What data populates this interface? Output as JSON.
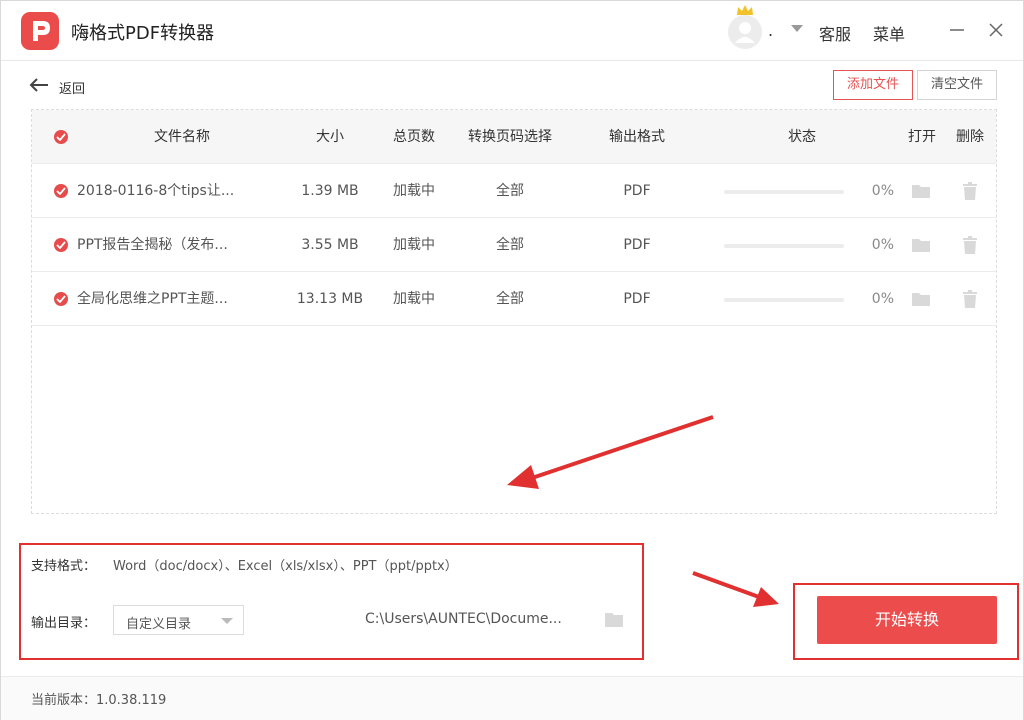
{
  "app": {
    "title": "嗨格式PDF转换器"
  },
  "header": {
    "username": ".",
    "service_label": "客服",
    "menu_label": "菜单"
  },
  "toolbar": {
    "back_label": "返回",
    "add_file_label": "添加文件",
    "clear_files_label": "清空文件"
  },
  "table": {
    "columns": {
      "name": "文件名称",
      "size": "大小",
      "pages": "总页数",
      "range": "转换页码选择",
      "format": "输出格式",
      "status": "状态",
      "open": "打开",
      "delete": "删除"
    },
    "rows": [
      {
        "name": "2018-0116-8个tips让...",
        "size": "1.39 MB",
        "pages": "加载中",
        "range": "全部",
        "format": "PDF",
        "progress": 0,
        "percent": "0%"
      },
      {
        "name": "PPT报告全揭秘（发布...",
        "size": "3.55 MB",
        "pages": "加载中",
        "range": "全部",
        "format": "PDF",
        "progress": 0,
        "percent": "0%"
      },
      {
        "name": "全局化思维之PPT主题...",
        "size": "13.13 MB",
        "pages": "加载中",
        "range": "全部",
        "format": "PDF",
        "progress": 0,
        "percent": "0%"
      }
    ]
  },
  "options": {
    "formats_label": "支持格式：",
    "formats_value": "Word（doc/docx）、Excel（xls/xlsx）、PPT（ppt/pptx）",
    "output_label": "输出目录：",
    "output_select_value": "自定义目录",
    "output_path": "C:\\Users\\AUNTEC\\Docume..."
  },
  "actions": {
    "start_label": "开始转换"
  },
  "footer": {
    "version_text": "当前版本：1.0.38.119"
  },
  "colors": {
    "accent": "#ec4c4c",
    "annotation": "#e03030"
  }
}
